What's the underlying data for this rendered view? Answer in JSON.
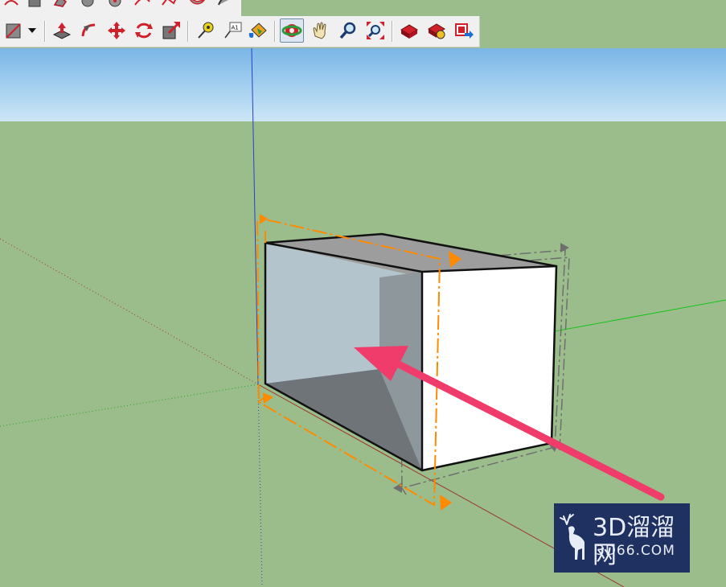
{
  "colors": {
    "sky_top": "#7ab6e6",
    "ground": "#9bbd8c",
    "axis_blue": "#2a3fc9",
    "axis_green": "#18c418",
    "axis_red": "#a0342c",
    "selection_orange": "#ff8a00",
    "ghost_gray": "#707070",
    "arrow_pink": "#f03c6a",
    "watermark_bg": "#1f3160"
  },
  "toolbar_top": {
    "icons": [
      "arc-icon",
      "shape-icon",
      "polygon-icon",
      "circle-icon",
      "circle-icon",
      "arc-icon",
      "freehand-icon",
      "pie-icon",
      "arc-icon"
    ]
  },
  "toolbar": {
    "icons": [
      "eraser-icon",
      "dropdown-arrow-icon",
      "push-pull-icon",
      "follow-me-icon",
      "move-icon",
      "rotate-icon",
      "scale-icon",
      "tape-measure-icon",
      "text-icon",
      "paint-bucket-icon",
      "orbit-icon",
      "pan-icon",
      "zoom-icon",
      "zoom-extents-icon",
      "warehouse-icon",
      "extension-warehouse-icon",
      "share-model-icon"
    ],
    "text_tool_glyph": "A1",
    "active_tool": "orbit-icon"
  },
  "watermark": {
    "line1": "3D溜溜网",
    "line2": "3D66.COM",
    "icon": "deer-logo-icon"
  }
}
